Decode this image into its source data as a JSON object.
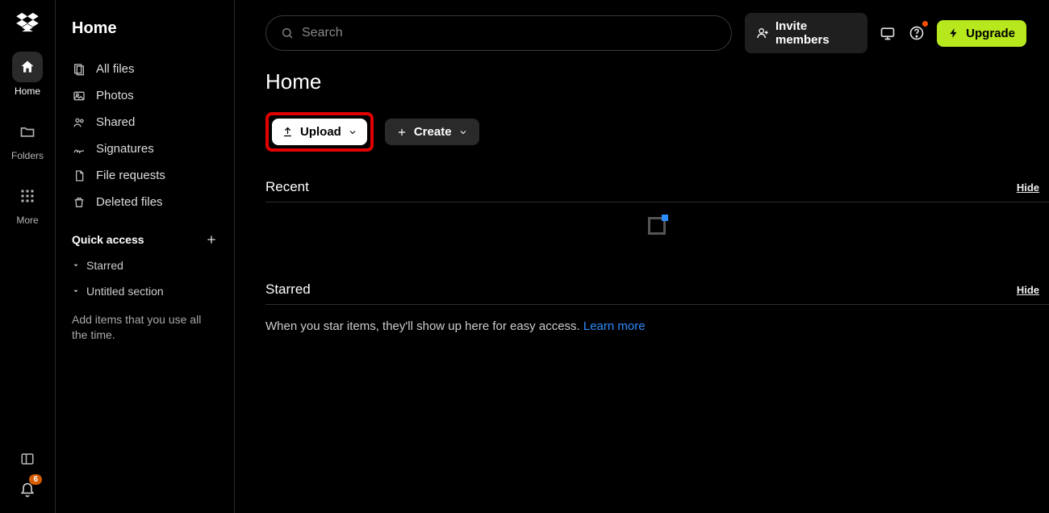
{
  "rail": {
    "items": [
      {
        "label": "Home"
      },
      {
        "label": "Folders"
      },
      {
        "label": "More"
      }
    ],
    "notifications_count": "6"
  },
  "sidebar": {
    "title": "Home",
    "nav": [
      {
        "label": "All files"
      },
      {
        "label": "Photos"
      },
      {
        "label": "Shared"
      },
      {
        "label": "Signatures"
      },
      {
        "label": "File requests"
      },
      {
        "label": "Deleted files"
      }
    ],
    "quick_access_title": "Quick access",
    "sections": [
      {
        "label": "Starred"
      },
      {
        "label": "Untitled section"
      }
    ],
    "hint": "Add items that you use all the time."
  },
  "topbar": {
    "search_placeholder": "Search",
    "invite_label": "Invite members",
    "upgrade_label": "Upgrade"
  },
  "page": {
    "title": "Home",
    "upload_label": "Upload",
    "create_label": "Create",
    "recent": {
      "title": "Recent",
      "hide": "Hide"
    },
    "starred": {
      "title": "Starred",
      "hide": "Hide",
      "empty_text": "When you star items, they'll show up here for easy access. ",
      "learn_more": "Learn more"
    }
  }
}
